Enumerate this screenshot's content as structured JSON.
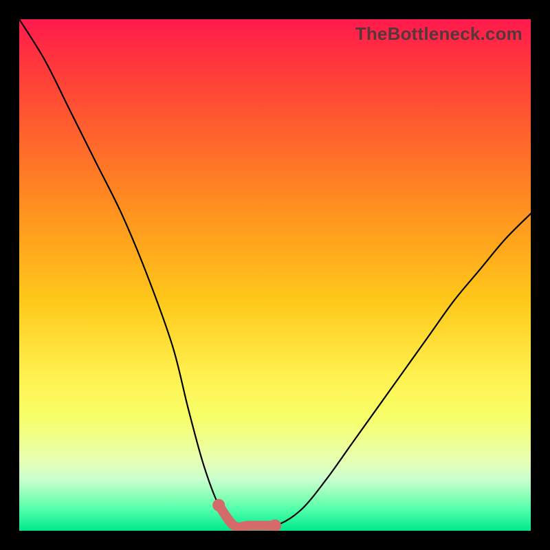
{
  "watermark": "TheBottleneck.com",
  "colors": {
    "background": "#000000",
    "curve": "#000000",
    "valley_highlight": "#d46a6a",
    "gradient_top": "#ff1a4d",
    "gradient_bottom": "#00e88a"
  },
  "chart_data": {
    "type": "line",
    "title": "",
    "xlabel": "",
    "ylabel": "",
    "xlim": [
      0,
      100
    ],
    "ylim": [
      0,
      100
    ],
    "grid": false,
    "legend": false,
    "series": [
      {
        "name": "bottleneck-curve",
        "x": [
          0,
          5,
          10,
          15,
          20,
          25,
          30,
          33,
          36,
          39,
          42,
          45,
          50,
          55,
          60,
          65,
          70,
          75,
          80,
          85,
          90,
          95,
          100
        ],
        "y": [
          100,
          92,
          82,
          72,
          62,
          50,
          36,
          24,
          13,
          5,
          1,
          1,
          1,
          4,
          10,
          17,
          24,
          31,
          38,
          45,
          51,
          57,
          62
        ]
      }
    ],
    "annotations": [
      {
        "name": "valley-highlight",
        "x_range": [
          37,
          51
        ],
        "color": "#d46a6a"
      }
    ]
  }
}
